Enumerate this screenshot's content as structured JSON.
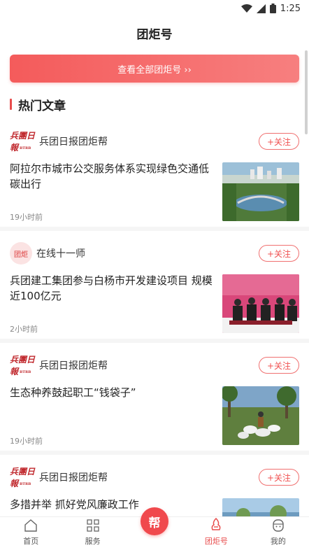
{
  "status_bar": {
    "time": "1:25"
  },
  "header": {
    "title": "团炬号"
  },
  "banner": {
    "label": "查看全部团炬号 ››"
  },
  "section": {
    "title": "热门文章"
  },
  "articles": [
    {
      "source": "兵团日报团炬帮",
      "logo": "兵团日报",
      "follow": "+关注",
      "title": "阿拉尔市城市公交服务体系实现绿色交通低碳出行",
      "time": "19小时前"
    },
    {
      "source": "在线十一师",
      "logo": "团炬",
      "follow": "+关注",
      "title": "兵团建工集团参与白杨市开发建设项目 规模近100亿元",
      "time": "2小时前"
    },
    {
      "source": "兵团日报团炬帮",
      "logo": "兵团日报",
      "follow": "+关注",
      "title": "生态种养鼓起职工“钱袋子”",
      "time": "19小时前"
    },
    {
      "source": "兵团日报团炬帮",
      "logo": "兵团日报",
      "follow": "+关注",
      "title": "多措并举 抓好党风廉政工作",
      "time": ""
    }
  ],
  "tabbar": {
    "home": "首页",
    "service": "服务",
    "center": "帮",
    "tuanju": "团炬号",
    "mine": "我的"
  },
  "colors": {
    "accent": "#e84c4c",
    "banner_start": "#f45b5b",
    "banner_end": "#f77f7f"
  }
}
